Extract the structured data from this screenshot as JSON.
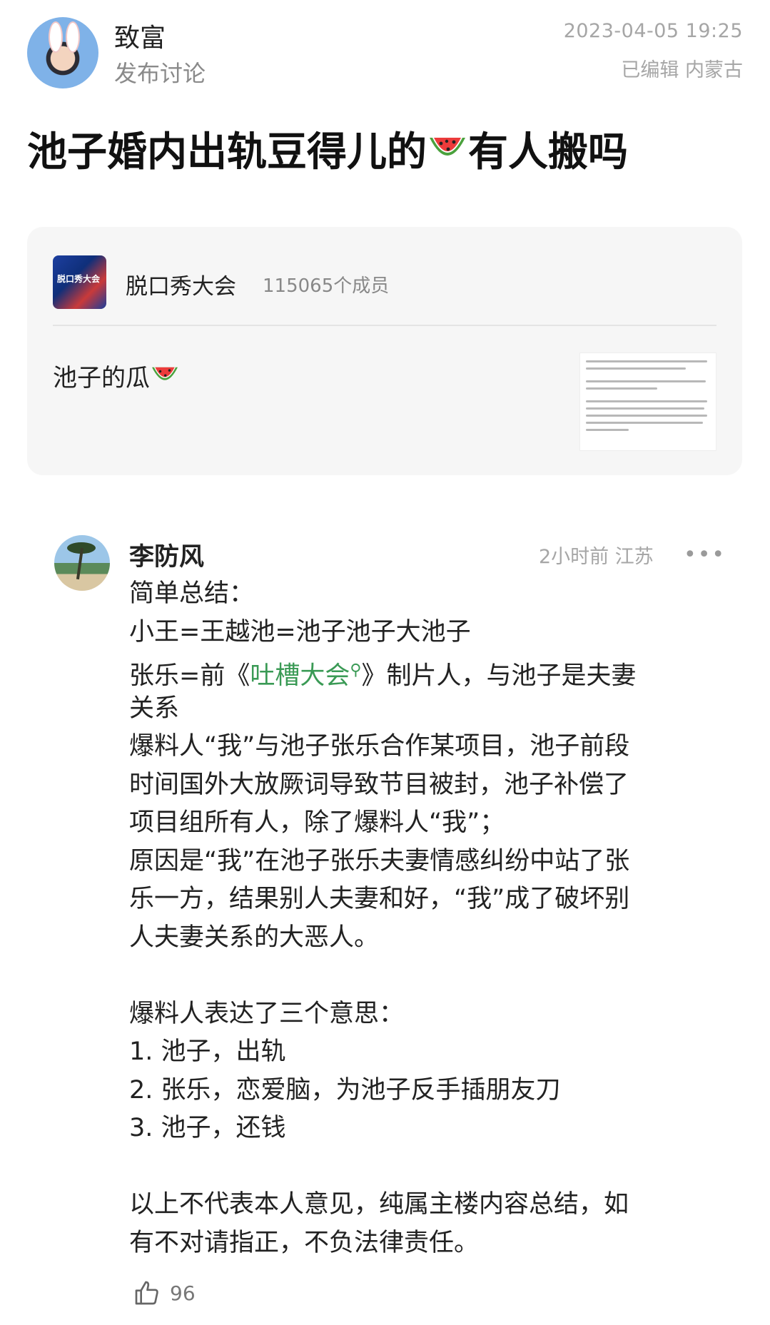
{
  "post": {
    "author": "致富",
    "action": "发布讨论",
    "datetime": "2023-04-05 19:25",
    "edited_location": "已编辑 内蒙古",
    "title_part1": "池子婚内出轨豆得儿的",
    "title_part2": "有人搬吗"
  },
  "group_card": {
    "name": "脱口秀大会",
    "members": "115065个成员",
    "post_text": "池子的瓜",
    "thumb_icon_text": "脱口秀大会"
  },
  "comment": {
    "author": "李防风",
    "time_location": "2小时前 江苏",
    "more": "•••",
    "lines": [
      "简单总结：",
      "小王=王越池=池子池子大池子",
      "张乐=前《",
      "吐槽大会",
      "》制片人，与池子是夫妻",
      "关系",
      "爆料人“我”与池子张乐合作某项目，池子前段",
      "时间国外大放厥词导致节目被封，池子补偿了",
      "项目组所有人，除了爆料人“我”；",
      "原因是“我”在池子张乐夫妻情感纠纷中站了张",
      "乐一方，结果别人夫妻和好，“我”成了破坏别",
      "人夫妻关系的大恶人。",
      "",
      "爆料人表达了三个意思：",
      "1. 池子，出轨",
      "2. 张乐，恋爱脑，为池子反手插朋友刀",
      "3. 池子，还钱",
      "",
      "以上不代表本人意见，纯属主楼内容总结，如",
      "有不对请指正，不负法律责任。"
    ],
    "likes": "96"
  },
  "icons": {
    "watermelon": "watermelon-icon",
    "search": "search-icon",
    "thumbs_up": "thumbs-up-icon",
    "more": "more-icon"
  },
  "colors": {
    "link_green": "#3a9a55",
    "meta_gray": "#a6a6a6",
    "card_bg": "#f6f6f6"
  }
}
